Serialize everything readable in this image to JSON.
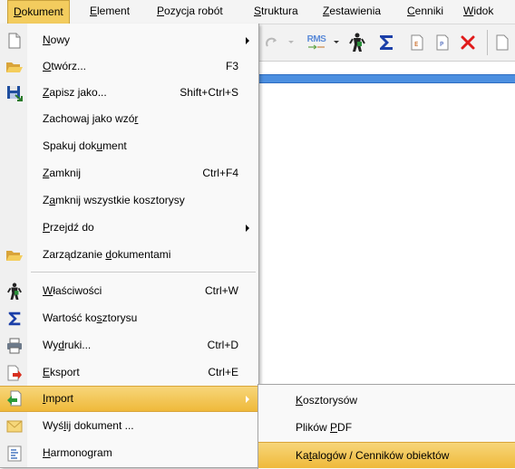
{
  "menubar": {
    "items": [
      {
        "pre": "",
        "ul": "D",
        "post": "okument"
      },
      {
        "pre": "",
        "ul": "E",
        "post": "lement"
      },
      {
        "pre": "",
        "ul": "P",
        "post": "ozycja robót"
      },
      {
        "pre": "",
        "ul": "S",
        "post": "truktura"
      },
      {
        "pre": "",
        "ul": "Z",
        "post": "estawienia"
      },
      {
        "pre": "",
        "ul": "C",
        "post": "enniki"
      },
      {
        "pre": "",
        "ul": "W",
        "post": "idok"
      }
    ]
  },
  "toolbar": {
    "rms_label": "RMS"
  },
  "menu": {
    "items": [
      {
        "pre": "",
        "ul": "N",
        "post": "owy",
        "shortcut": "",
        "icon": "new-document-icon"
      },
      {
        "pre": "",
        "ul": "O",
        "post": "twórz...",
        "shortcut": "F3",
        "icon": "open-folder-icon"
      },
      {
        "pre": "",
        "ul": "Z",
        "post": "apisz jako...",
        "shortcut": "Shift+Ctrl+S",
        "icon": "save-as-icon"
      },
      {
        "pre": "Zachowaj jako wzó",
        "ul": "r",
        "post": "",
        "shortcut": "",
        "icon": ""
      },
      {
        "pre": "Spakuj dok",
        "ul": "u",
        "post": "ment",
        "shortcut": "",
        "icon": ""
      },
      {
        "pre": "",
        "ul": "Z",
        "post": "amknij",
        "shortcut": "Ctrl+F4",
        "icon": ""
      },
      {
        "pre": "Z",
        "ul": "a",
        "post": "mknij wszystkie kosztorysy",
        "shortcut": "",
        "icon": ""
      },
      {
        "pre": "",
        "ul": "P",
        "post": "rzejdź do",
        "shortcut": "",
        "icon": ""
      },
      {
        "pre": "Zarządzanie ",
        "ul": "d",
        "post": "okumentami",
        "shortcut": "",
        "icon": "folder-icon"
      },
      {
        "pre": "",
        "ul": "W",
        "post": "łaściwości",
        "shortcut": "Ctrl+W",
        "icon": "person-icon"
      },
      {
        "pre": "Wartość ko",
        "ul": "s",
        "post": "ztorysu",
        "shortcut": "",
        "icon": "sigma-icon"
      },
      {
        "pre": "Wy",
        "ul": "d",
        "post": "ruki...",
        "shortcut": "Ctrl+D",
        "icon": "printer-icon"
      },
      {
        "pre": "",
        "ul": "E",
        "post": "ksport",
        "shortcut": "Ctrl+E",
        "icon": "export-icon"
      },
      {
        "pre": "",
        "ul": "I",
        "post": "mport",
        "shortcut": "",
        "icon": "import-icon"
      },
      {
        "pre": "Wyś",
        "ul": "l",
        "post": "ij dokument ...",
        "shortcut": "",
        "icon": "envelope-icon"
      },
      {
        "pre": "",
        "ul": "H",
        "post": "armonogram",
        "shortcut": "",
        "icon": "schedule-icon"
      }
    ]
  },
  "submenu": {
    "items": [
      {
        "pre": "",
        "ul": "K",
        "post": "osztorysów"
      },
      {
        "pre": "Plików ",
        "ul": "P",
        "post": "DF"
      },
      {
        "pre": "Ka",
        "ul": "t",
        "post": "alogów / Cenników obiektów"
      }
    ]
  },
  "colors": {
    "highlight": "#f3c654",
    "blue_bar": "#4c8fe0",
    "menu_bg": "#f9f9f9",
    "delete_red": "#e01b1b",
    "sigma_blue": "#1b3fa8"
  }
}
